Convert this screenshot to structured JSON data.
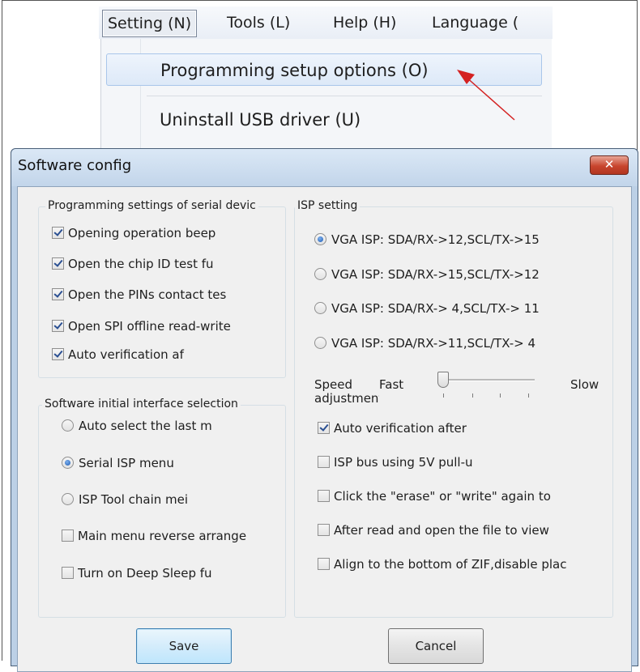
{
  "menubar": {
    "items": [
      {
        "label": "Setting (N)",
        "active": true
      },
      {
        "label": "Tools (L)",
        "active": false
      },
      {
        "label": "Help (H)",
        "active": false
      },
      {
        "label": "Language (",
        "active": false
      }
    ]
  },
  "dropdown": {
    "items": [
      {
        "label": "Programming setup options (O)",
        "hover": true
      },
      {
        "label": "Uninstall USB driver (U)",
        "hover": false
      }
    ]
  },
  "annotation": {
    "arrow_color": "#d42121"
  },
  "dialog": {
    "title": "Software config",
    "close_glyph": "✕",
    "serial_group": {
      "title": "Programming settings of serial devic",
      "items": [
        {
          "label": "Opening operation beep",
          "checked": true
        },
        {
          "label": "Open the chip ID test fu",
          "checked": true
        },
        {
          "label": "Open the PINs contact tes",
          "checked": true
        },
        {
          "label": "Open SPI offline read-write",
          "checked": true
        },
        {
          "label": "Auto verification af",
          "checked": true
        }
      ]
    },
    "isp_group": {
      "title": "ISP setting",
      "options": [
        {
          "label": "VGA ISP: SDA/RX->12,SCL/TX->15",
          "selected": true
        },
        {
          "label": "VGA ISP: SDA/RX->15,SCL/TX->12",
          "selected": false
        },
        {
          "label": "VGA ISP: SDA/RX-> 4,SCL/TX-> 11",
          "selected": false
        },
        {
          "label": "VGA ISP: SDA/RX->11,SCL/TX-> 4",
          "selected": false
        }
      ],
      "speed": {
        "label": "Speed adjustment:",
        "fast": "Fast",
        "slow": "Slow",
        "level": 0
      },
      "checks": [
        {
          "label": "Auto verification after",
          "checked": true
        },
        {
          "label": "ISP bus using 5V pull-u",
          "checked": false
        },
        {
          "label": "Click the \"erase\" or \"write\" again to",
          "checked": false
        },
        {
          "label": "After read and open the file to view",
          "checked": false
        },
        {
          "label": "Align to the bottom of ZIF,disable plac",
          "checked": false
        }
      ]
    },
    "interface_group": {
      "title": "Software initial interface selection",
      "options": [
        {
          "label": "Auto select the last m",
          "selected": false
        },
        {
          "label": "Serial ISP menu",
          "selected": true
        },
        {
          "label": "ISP Tool chain mei",
          "selected": false
        }
      ],
      "checks": [
        {
          "label": "Main menu reverse arrange",
          "checked": false
        },
        {
          "label": "Turn on Deep Sleep fu",
          "checked": false
        }
      ]
    },
    "buttons": {
      "save": "Save",
      "cancel": "Cancel"
    }
  }
}
